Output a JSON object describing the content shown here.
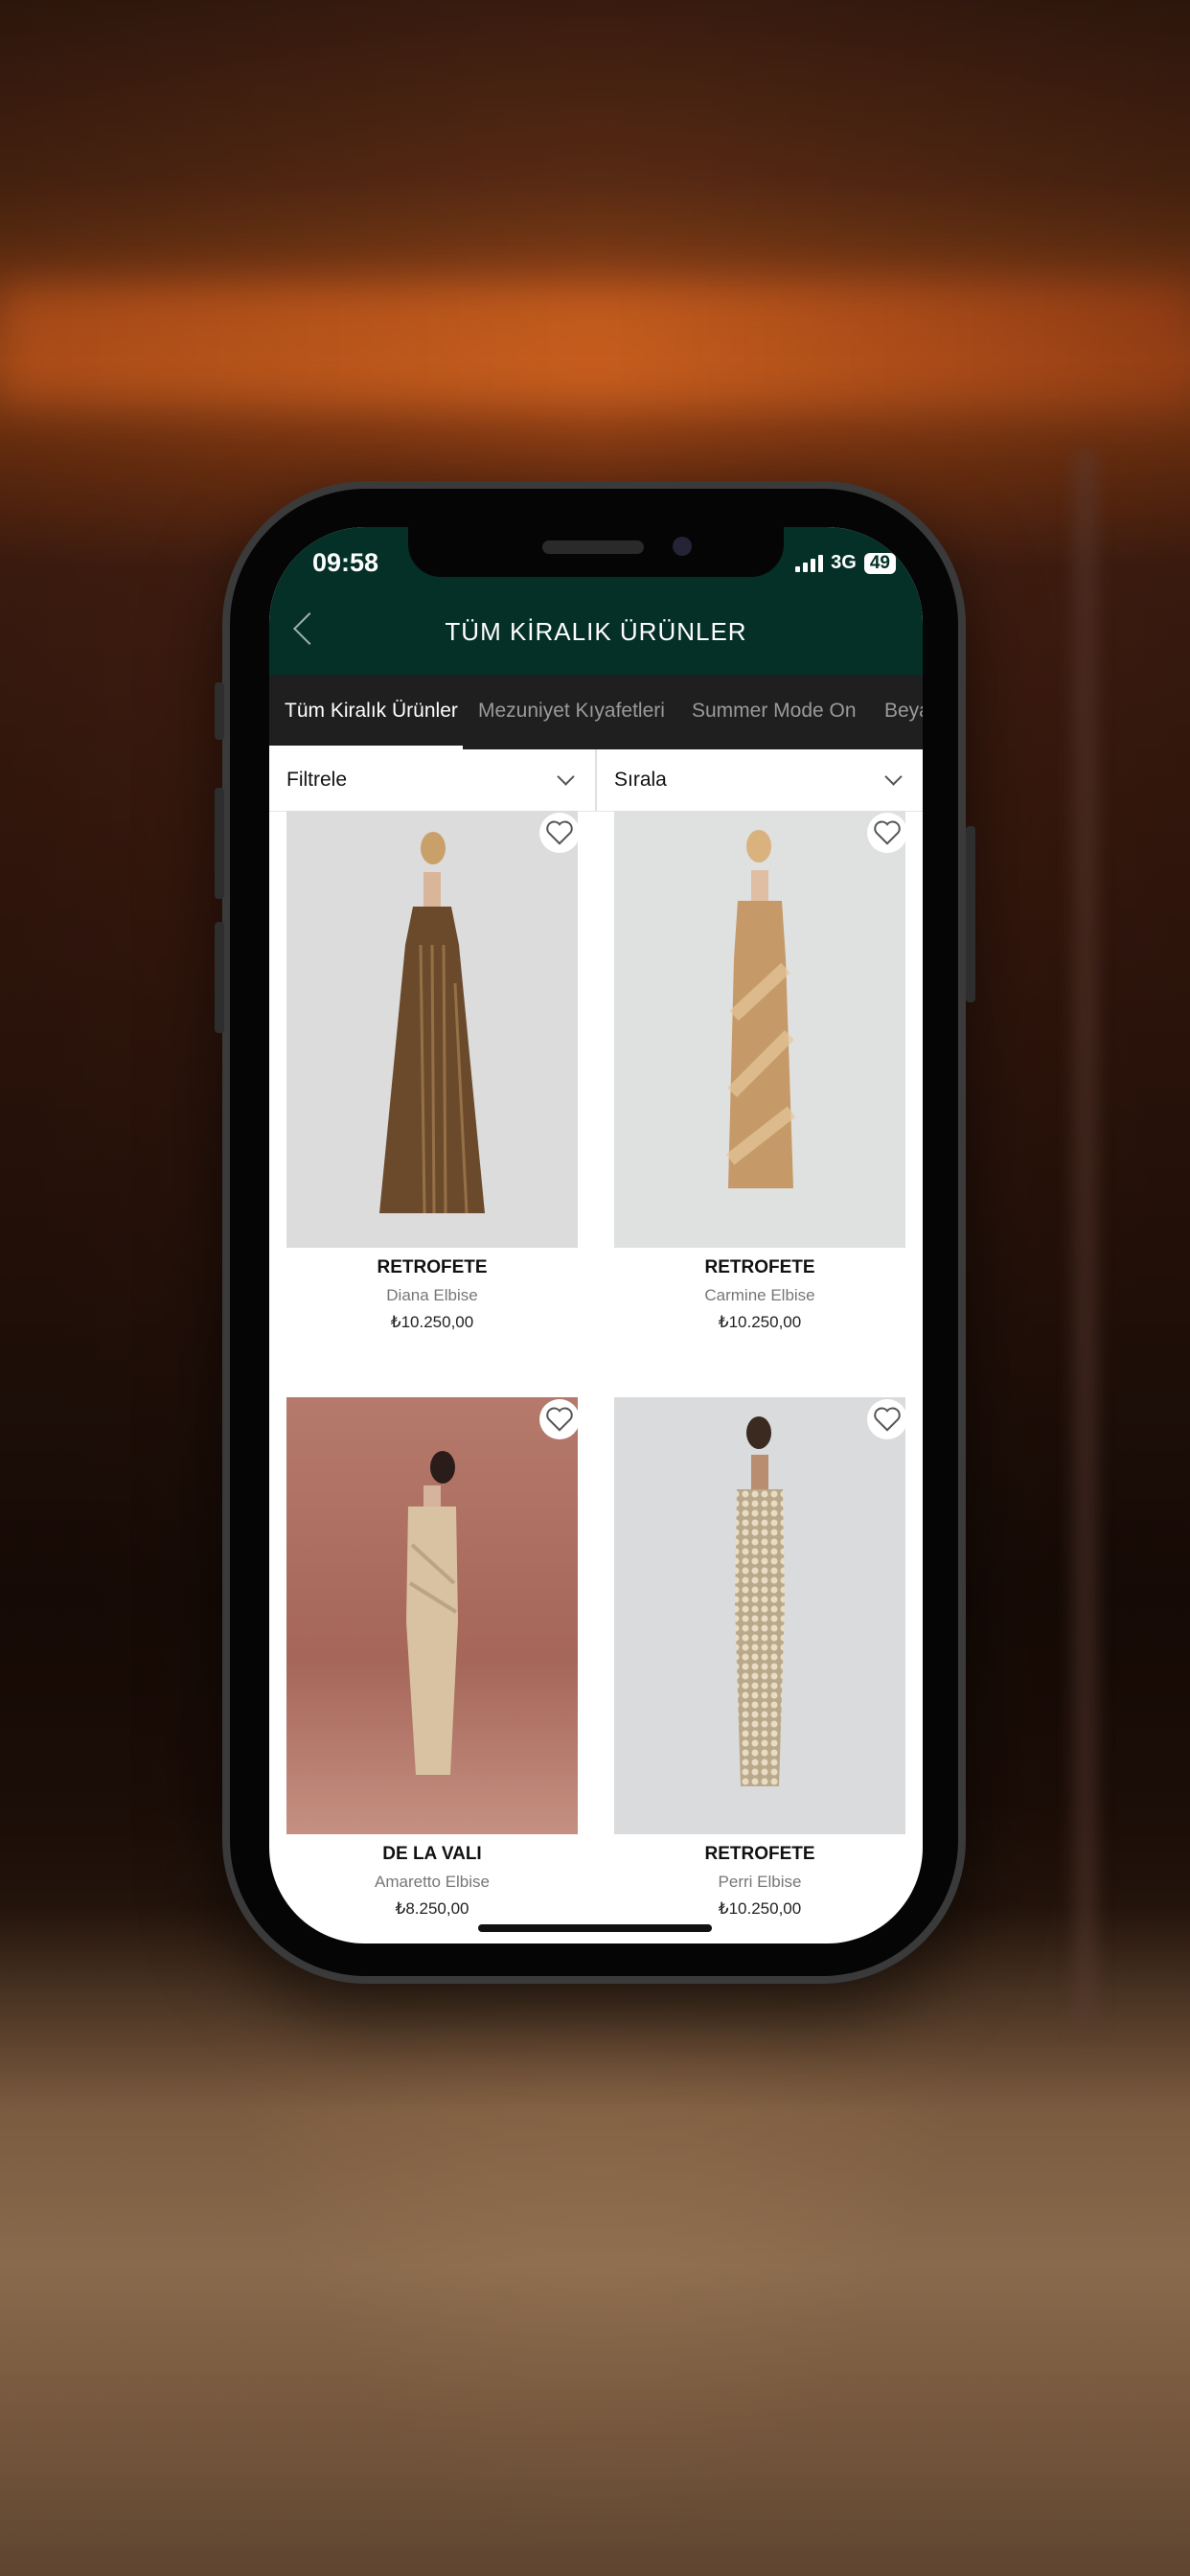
{
  "status_bar": {
    "time": "09:58",
    "network": "3G",
    "battery": "49"
  },
  "header": {
    "title": "TÜM KİRALIK ÜRÜNLER"
  },
  "tabs": [
    {
      "label": "Tüm Kiralık Ürünler",
      "active": true
    },
    {
      "label": "Mezuniyet Kıyafetleri",
      "active": false
    },
    {
      "label": "Summer Mode On",
      "active": false
    },
    {
      "label": "Beya",
      "active": false
    }
  ],
  "filters": {
    "filter_label": "Filtrele",
    "sort_label": "Sırala"
  },
  "products": [
    {
      "brand": "RETROFETE",
      "name": "Diana Elbise",
      "price": "₺10.250,00",
      "icon": "heart-outline-icon",
      "bg": "#dcdcdc",
      "dress": "#6b4a2c"
    },
    {
      "brand": "RETROFETE",
      "name": "Carmine Elbise",
      "price": "₺10.250,00",
      "icon": "heart-outline-icon",
      "bg": "#dfe0e0",
      "dress": "#c59a68"
    },
    {
      "brand": "DE LA VALI",
      "name": "Amaretto Elbise",
      "price": "₺8.250,00",
      "icon": "heart-outline-icon",
      "bg": "#a6665a",
      "dress": "#d8c2a1"
    },
    {
      "brand": "RETROFETE",
      "name": "Perri Elbise",
      "price": "₺10.250,00",
      "icon": "heart-outline-icon",
      "bg": "#dadbdc",
      "dress": "#b9a98a"
    }
  ],
  "colors": {
    "header_bg": "#043027",
    "tabs_bg": "#1f1f1f"
  }
}
